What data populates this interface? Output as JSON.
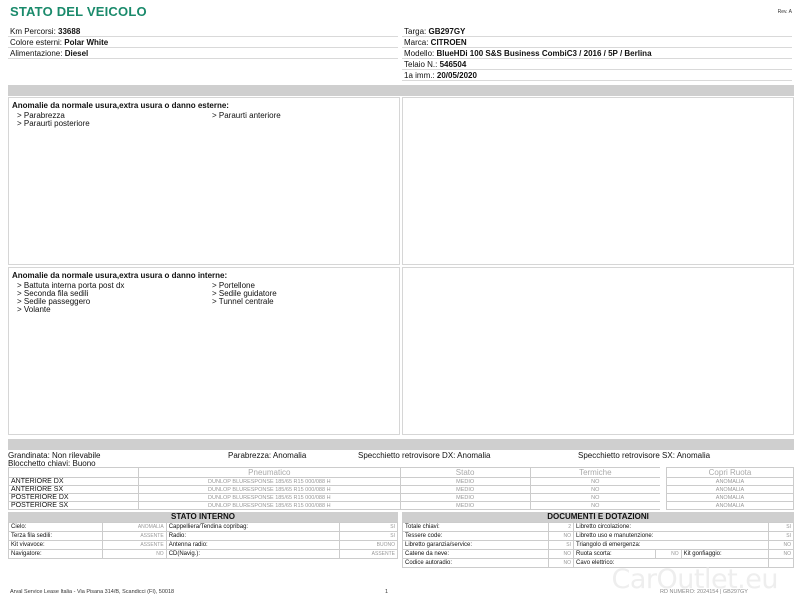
{
  "title": "STATO DEL VEICOLO",
  "rev": "Rev. A",
  "vehicle_left": [
    {
      "label": "Km Percorsi: ",
      "value": "33688"
    },
    {
      "label": "Colore esterni: ",
      "value": "Polar White"
    },
    {
      "label": "Alimentazione: ",
      "value": "Diesel"
    }
  ],
  "vehicle_right": [
    {
      "label": "Targa: ",
      "value": "GB297GY"
    },
    {
      "label": "Marca: ",
      "value": "CITROEN"
    },
    {
      "label": "Modello: ",
      "value": "BlueHDi 100 S&S Business CombiC3 / 2016 / 5P / Berlina"
    },
    {
      "label": "Telaio N.: ",
      "value": "546504"
    },
    {
      "label": "1a imm.: ",
      "value": "20/05/2020"
    }
  ],
  "damage_external": {
    "title": "Anomalie da normale usura,extra usura o danno esterne:",
    "items": [
      "> Parabrezza",
      "> Paraurti anteriore",
      "> Paraurti posteriore"
    ]
  },
  "damage_internal": {
    "title": "Anomalie da normale usura,extra usura o danno interne:",
    "items": [
      "> Battuta interna porta post dx",
      "> Portellone",
      "> Seconda fila sedili",
      "> Sedile guidatore",
      "> Sedile passeggero",
      "> Tunnel centrale",
      "> Volante"
    ]
  },
  "status": {
    "grandinata": "Grandinata: Non rilevabile",
    "blocchetto": "Blocchetto chiavi: Buono",
    "parabrezza": "Parabrezza: Anomalia",
    "specchietto_dx": "Specchietto retrovisore DX: Anomalia",
    "specchietto_sx": "Specchietto retrovisore SX: Anomalia"
  },
  "tyres": {
    "headers": [
      "",
      "Pneumatico",
      "Stato",
      "Termiche"
    ],
    "rows": [
      {
        "pos": "ANTERIORE DX",
        "tyre": "DUNLOP BLURESPONSE 185/65 R15 000/088 H",
        "stato": "MEDIO",
        "termiche": "NO"
      },
      {
        "pos": "ANTERIORE SX",
        "tyre": "DUNLOP BLURESPONSE 185/65 R15 000/088 H",
        "stato": "MEDIO",
        "termiche": "NO"
      },
      {
        "pos": "POSTERIORE DX",
        "tyre": "DUNLOP BLURESPONSE 185/65 R15 000/088 H",
        "stato": "MEDIO",
        "termiche": "NO"
      },
      {
        "pos": "POSTERIORE SX",
        "tyre": "DUNLOP BLURESPONSE 185/65 R15 000/088 H",
        "stato": "MEDIO",
        "termiche": "NO"
      }
    ]
  },
  "copri_ruota": {
    "header": "Copri Ruota",
    "rows": [
      "ANOMALIA",
      "ANOMALIA",
      "ANOMALIA",
      "ANOMALIA"
    ]
  },
  "stato_interno": {
    "title": "STATO INTERNO",
    "rows": [
      [
        {
          "l": "Cielo:",
          "v": "ANOMALIA"
        },
        {
          "l": "Cappelliera/Tendina copribag:",
          "v": "SI"
        }
      ],
      [
        {
          "l": "Terza fila sedili:",
          "v": "ASSENTE"
        },
        {
          "l": "Radio:",
          "v": "SI"
        }
      ],
      [
        {
          "l": "Kit vivavoce:",
          "v": "ASSENTE"
        },
        {
          "l": "Antenna radio:",
          "v": "BUONO"
        }
      ],
      [
        {
          "l": "Navigatore:",
          "v": "NO"
        },
        {
          "l": "CD(Navig.):",
          "v": "ASSENTE"
        }
      ]
    ]
  },
  "documenti": {
    "title": "DOCUMENTI E DOTAZIONI",
    "rows": [
      [
        {
          "l": "Totale chiavi:",
          "v": "2"
        },
        {
          "l": "Libretto circolazione:",
          "v": "SI"
        }
      ],
      [
        {
          "l": "Tessere code:",
          "v": "NO"
        },
        {
          "l": "Libretto uso e manutenzione:",
          "v": "SI"
        }
      ],
      [
        {
          "l": "Libretto garanzia/service:",
          "v": "SI"
        },
        {
          "l": "Triangolo di emergenza:",
          "v": "NO"
        }
      ],
      [
        {
          "l": "Catene da neve:",
          "v": "NO"
        },
        {
          "l": "Ruota scorta:",
          "v": "NO"
        },
        {
          "l": "Kit gonfiaggio:",
          "v": "NO"
        }
      ],
      [
        {
          "l": "Codice autoradio:",
          "v": "NO"
        },
        {
          "l": "Cavo elettrico:",
          "v": ""
        }
      ]
    ]
  },
  "footer": {
    "company": "Arval Service Lease Italia - Via Pisana 314/B, Scandicci (FI), 50018",
    "page": "1",
    "ref": "RD NUMERO: 2024154 | GB297GY"
  },
  "watermark": "CarOutlet.eu"
}
